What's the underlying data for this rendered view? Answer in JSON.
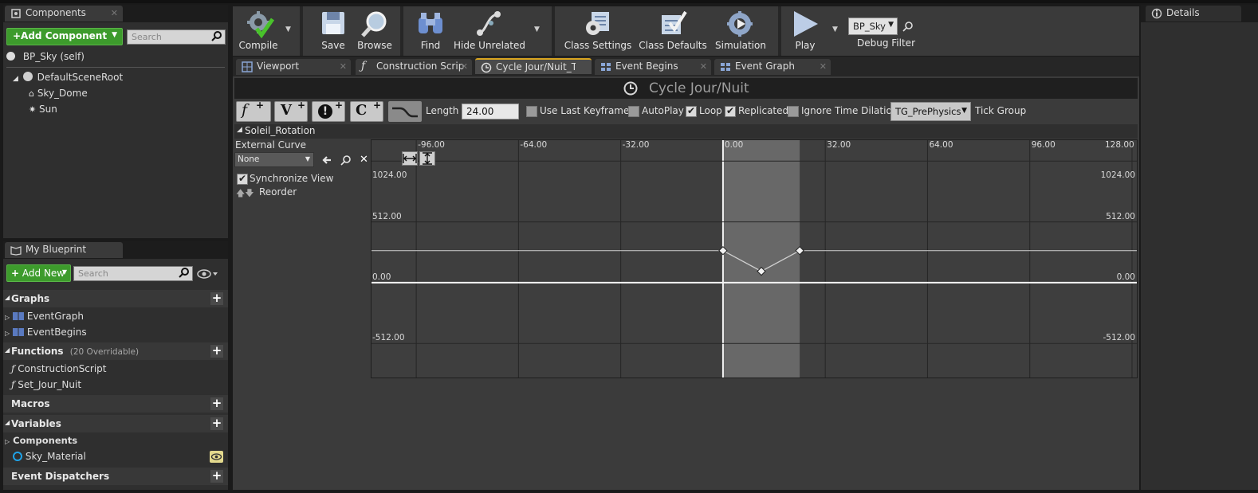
{
  "components_panel": {
    "tab_label": "Components",
    "add_component_label": "+Add Component",
    "search_placeholder": "Search",
    "self_label": "BP_Sky (self)",
    "tree": [
      {
        "label": "DefaultSceneRoot",
        "icon": "scene-root-icon"
      },
      {
        "label": "Sky_Dome",
        "icon": "static-mesh-icon"
      },
      {
        "label": "Sun",
        "icon": "sun-icon"
      }
    ]
  },
  "my_blueprint": {
    "tab_label": "My Blueprint",
    "add_new_label": "Add New",
    "search_placeholder": "Search",
    "sections": {
      "graphs": "Graphs",
      "functions": "Functions",
      "functions_note": "(20 Overridable)",
      "macros": "Macros",
      "variables": "Variables",
      "components_cat": "Components",
      "event_dispatchers": "Event Dispatchers"
    },
    "graphs": [
      "EventGraph",
      "EventBegins"
    ],
    "functions": [
      "ConstructionScript",
      "Set_Jour_Nuit"
    ],
    "variables": [
      "Sky_Material"
    ]
  },
  "toolbar": {
    "compile": "Compile",
    "save": "Save",
    "browse": "Browse",
    "find": "Find",
    "hide_unrelated": "Hide Unrelated",
    "class_settings": "Class Settings",
    "class_defaults": "Class Defaults",
    "simulation": "Simulation",
    "play": "Play",
    "debug_object": "BP_Sky",
    "debug_filter": "Debug Filter"
  },
  "doc_tabs": [
    {
      "label": "Viewport",
      "icon": "viewport-icon"
    },
    {
      "label": "Construction Scrip",
      "icon": "function-icon"
    },
    {
      "label": "Cycle Jour/Nuit_Te",
      "icon": "timeline-icon"
    },
    {
      "label": "Event Begins",
      "icon": "graph-icon"
    },
    {
      "label": "Event Graph",
      "icon": "graph-icon"
    }
  ],
  "timeline": {
    "title": "Cycle Jour/Nuit",
    "length_label": "Length",
    "length_value": "24.00",
    "use_last_keyframe": "Use Last Keyframe?",
    "autoplay": "AutoPlay",
    "loop": "Loop",
    "replicated": "Replicated",
    "ignore_time_dilation": "Ignore Time Dilation",
    "tick_group_value": "TG_PrePhysics",
    "tick_group_label": "Tick Group",
    "track_name": "Soleil_Rotation",
    "external_curve_label": "External Curve",
    "external_curve_value": "None",
    "sync_view": "Synchronize View",
    "reorder": "Reorder",
    "checks": {
      "use_last_keyframe": false,
      "autoplay": false,
      "loop": true,
      "replicated": true,
      "ignore_time_dilation": false,
      "sync_view": true
    }
  },
  "curve_graph": {
    "x_ticks": [
      "-96.00",
      "-64.00",
      "-32.00",
      "0.00",
      "32.00",
      "64.00",
      "96.00",
      "128.00"
    ],
    "y_ticks_left": [
      "1024.00",
      "512.00",
      "0.00",
      "-512.00"
    ],
    "y_ticks_right": [
      "1024.00",
      "512.00",
      "0.00",
      "-512.00"
    ],
    "keys": [
      {
        "x": 0,
        "y": 270
      },
      {
        "x": 12,
        "y": 96
      },
      {
        "x": 24,
        "y": 270
      }
    ]
  },
  "details_panel": {
    "tab_label": "Details"
  }
}
